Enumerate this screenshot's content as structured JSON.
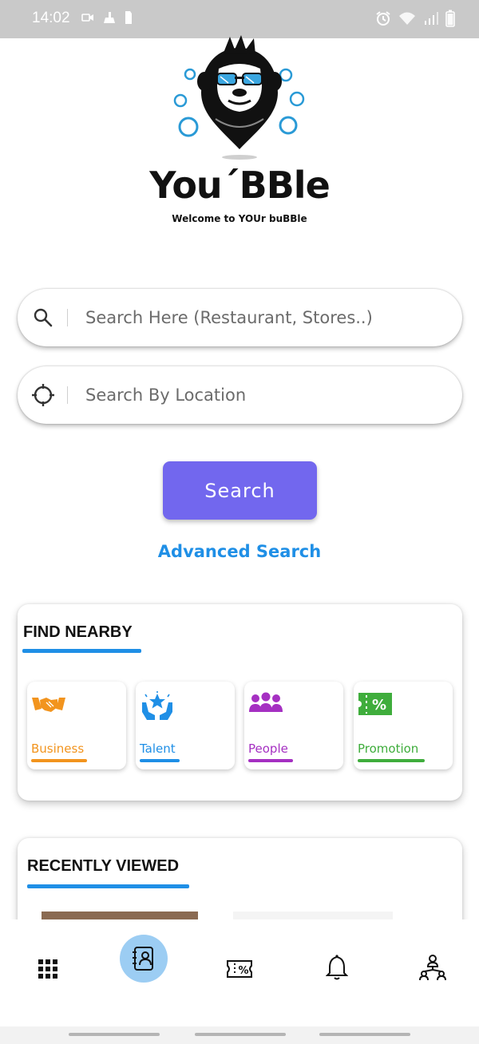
{
  "status_bar": {
    "time": "14:02",
    "icons_left": [
      "video-call-icon",
      "cleaner-icon",
      "sim-icon"
    ],
    "icons_right": [
      "alarm-icon",
      "wifi-icon",
      "signal-icon",
      "battery-icon"
    ]
  },
  "brand": {
    "name": "You´BBle",
    "tagline": "Welcome to YOUr buBBle"
  },
  "search": {
    "query_placeholder": "Search Here (Restaurant, Stores..)",
    "location_placeholder": "Search By Location",
    "button_label": "Search",
    "advanced_label": "Advanced Search"
  },
  "find_nearby": {
    "title": "FIND NEARBY",
    "items": [
      {
        "label": "Business",
        "icon": "handshake-icon",
        "color": "#f2941e"
      },
      {
        "label": "Talent",
        "icon": "star-hands-icon",
        "color": "#1f8fe6"
      },
      {
        "label": "People",
        "icon": "people-group-icon",
        "color": "#a530c2"
      },
      {
        "label": "Promotion",
        "icon": "percent-ticket-icon",
        "color": "#3fad3c"
      }
    ]
  },
  "recently_viewed": {
    "title": "RECENTLY VIEWED"
  },
  "bottom_nav": {
    "items": [
      "grid-menu-icon",
      "contacts-icon",
      "coupon-icon",
      "bell-icon",
      "network-icon"
    ],
    "active": "contacts-icon"
  },
  "colors": {
    "accent_button": "#7267ee",
    "link_blue": "#1f8fe6",
    "active_nav_bg": "#9ccdf3"
  }
}
